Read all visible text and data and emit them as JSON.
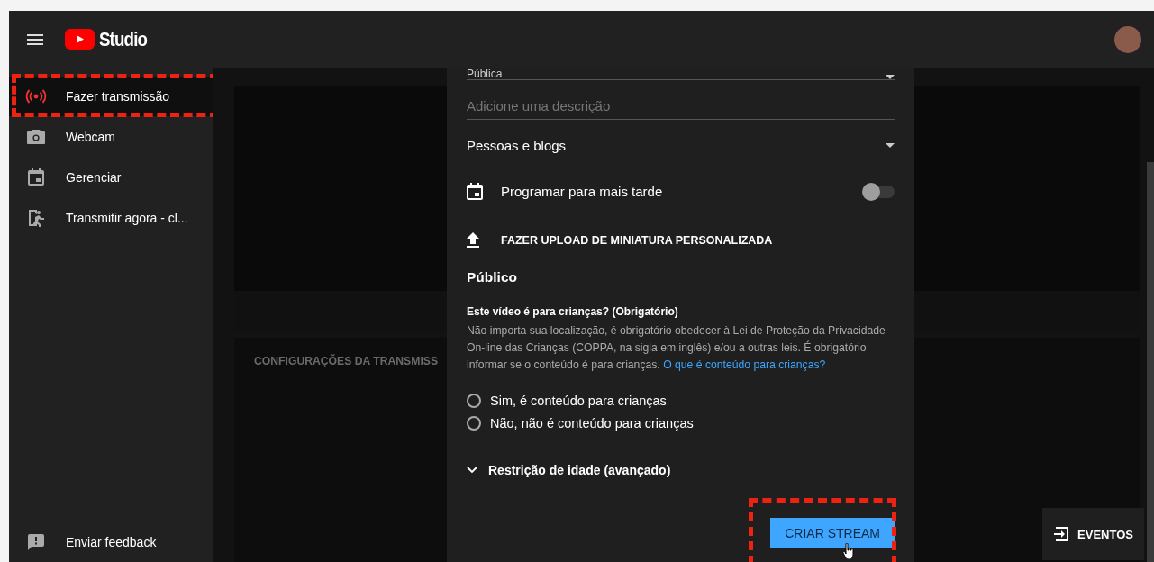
{
  "header": {
    "logo_text": "Studio"
  },
  "sidebar": {
    "items": [
      {
        "label": "Fazer transmissão",
        "selected": true
      },
      {
        "label": "Webcam",
        "selected": false
      },
      {
        "label": "Gerenciar",
        "selected": false
      },
      {
        "label": "Transmitir agora - cl...",
        "selected": false
      }
    ],
    "footer_item": {
      "label": "Enviar feedback"
    }
  },
  "background": {
    "section_title": "CONFIGURAÇÕES DA TRANSMISS"
  },
  "dialog": {
    "visibility": {
      "value": "Pública"
    },
    "description": {
      "placeholder": "Adicione uma descrição"
    },
    "category": {
      "value": "Pessoas e blogs"
    },
    "schedule": {
      "label": "Programar para mais tarde",
      "on": false
    },
    "upload_thumbnail": "FAZER UPLOAD DE MINIATURA PERSONALIZADA",
    "audience": {
      "title": "Público",
      "question": "Este vídeo é para crianças? (Obrigatório)",
      "explanation": "Não importa sua localização, é obrigatório obedecer à Lei de Proteção da Privacidade On-line das Crianças (COPPA, na sigla em inglês) e/ou a outras leis. É obrigatório informar se o conteúdo é para crianças.",
      "link": "O que é conteúdo para crianças?",
      "options": [
        {
          "label": "Sim, é conteúdo para crianças",
          "selected": false
        },
        {
          "label": "Não, não é conteúdo para crianças",
          "selected": false
        }
      ]
    },
    "age_restriction": {
      "label": "Restrição de idade (avançado)",
      "expanded": false
    },
    "create_button": "CRIAR STREAM"
  },
  "events_button": "EVENTOS"
}
